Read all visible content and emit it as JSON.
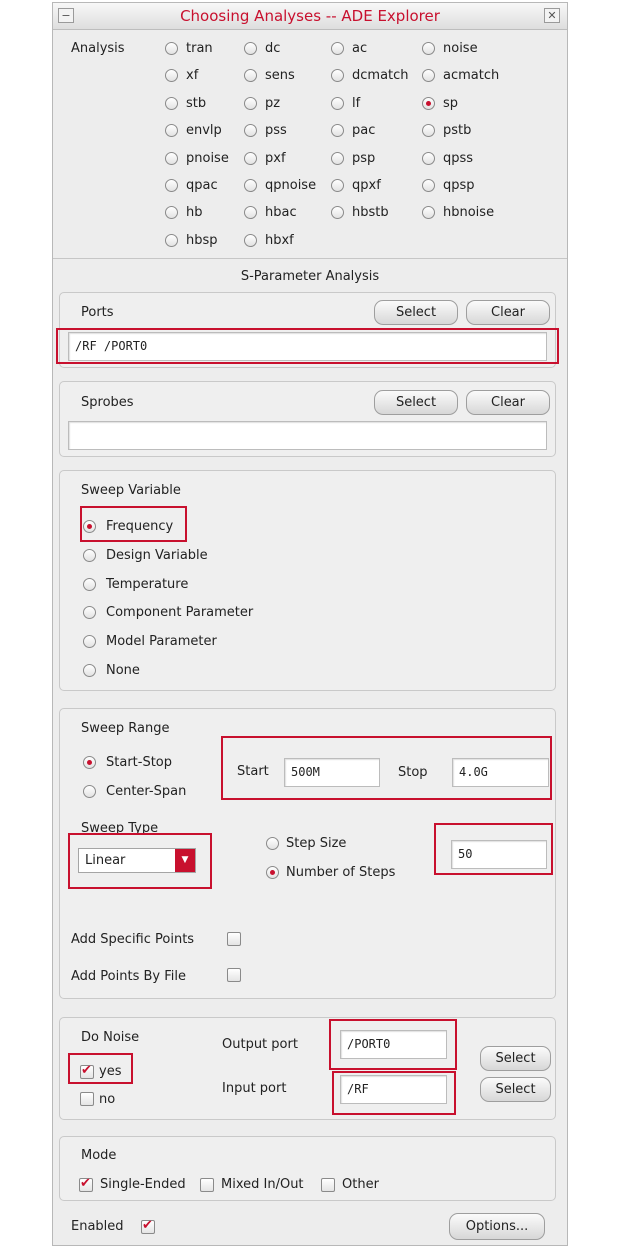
{
  "window": {
    "title": "Choosing Analyses -- ADE Explorer",
    "minimize_glyph": "−",
    "close_glyph": "✕"
  },
  "analysis": {
    "label": "Analysis",
    "selected": "sp",
    "options": [
      [
        "tran",
        "dc",
        "ac",
        "noise"
      ],
      [
        "xf",
        "sens",
        "dcmatch",
        "acmatch"
      ],
      [
        "stb",
        "pz",
        "lf",
        "sp"
      ],
      [
        "envlp",
        "pss",
        "pac",
        "pstb"
      ],
      [
        "pnoise",
        "pxf",
        "psp",
        "qpss"
      ],
      [
        "qpac",
        "qpnoise",
        "qpxf",
        "qpsp"
      ],
      [
        "hb",
        "hbac",
        "hbstb",
        "hbnoise"
      ],
      [
        "hbsp",
        "hbxf"
      ]
    ]
  },
  "section_title": "S-Parameter Analysis",
  "ports": {
    "label": "Ports",
    "select_label": "Select",
    "clear_label": "Clear",
    "value": "/RF /PORT0"
  },
  "sprobes": {
    "label": "Sprobes",
    "select_label": "Select",
    "clear_label": "Clear",
    "value": ""
  },
  "sweep_variable": {
    "label": "Sweep Variable",
    "selected": "Frequency",
    "options": [
      "Frequency",
      "Design Variable",
      "Temperature",
      "Component Parameter",
      "Model Parameter",
      "None"
    ]
  },
  "sweep_range": {
    "label": "Sweep Range",
    "options": [
      "Start-Stop",
      "Center-Span"
    ],
    "selected": "Start-Stop",
    "start_label": "Start",
    "start_value": "500M",
    "stop_label": "Stop",
    "stop_value": "4.0G"
  },
  "sweep_type": {
    "label": "Sweep Type",
    "value": "Linear",
    "step_options": [
      "Step Size",
      "Number of Steps"
    ],
    "step_selected": "Number of Steps",
    "steps_value": "50"
  },
  "add_specific_points": {
    "label": "Add Specific Points",
    "checked": false
  },
  "add_points_by_file": {
    "label": "Add Points By File",
    "checked": false
  },
  "noise": {
    "label": "Do Noise",
    "yes_label": "yes",
    "no_label": "no",
    "yes_checked": true,
    "no_checked": false,
    "output_port_label": "Output port",
    "output_port_value": "/PORT0",
    "input_port_label": "Input port",
    "input_port_value": "/RF",
    "select_label": "Select"
  },
  "mode": {
    "label": "Mode",
    "options": [
      {
        "label": "Single-Ended",
        "checked": true
      },
      {
        "label": "Mixed In/Out",
        "checked": false
      },
      {
        "label": "Other",
        "checked": false
      }
    ]
  },
  "enabled": {
    "label": "Enabled",
    "checked": true
  },
  "options_button": "Options...",
  "colors": {
    "accent": "#c8102e",
    "background": "#ededed"
  }
}
